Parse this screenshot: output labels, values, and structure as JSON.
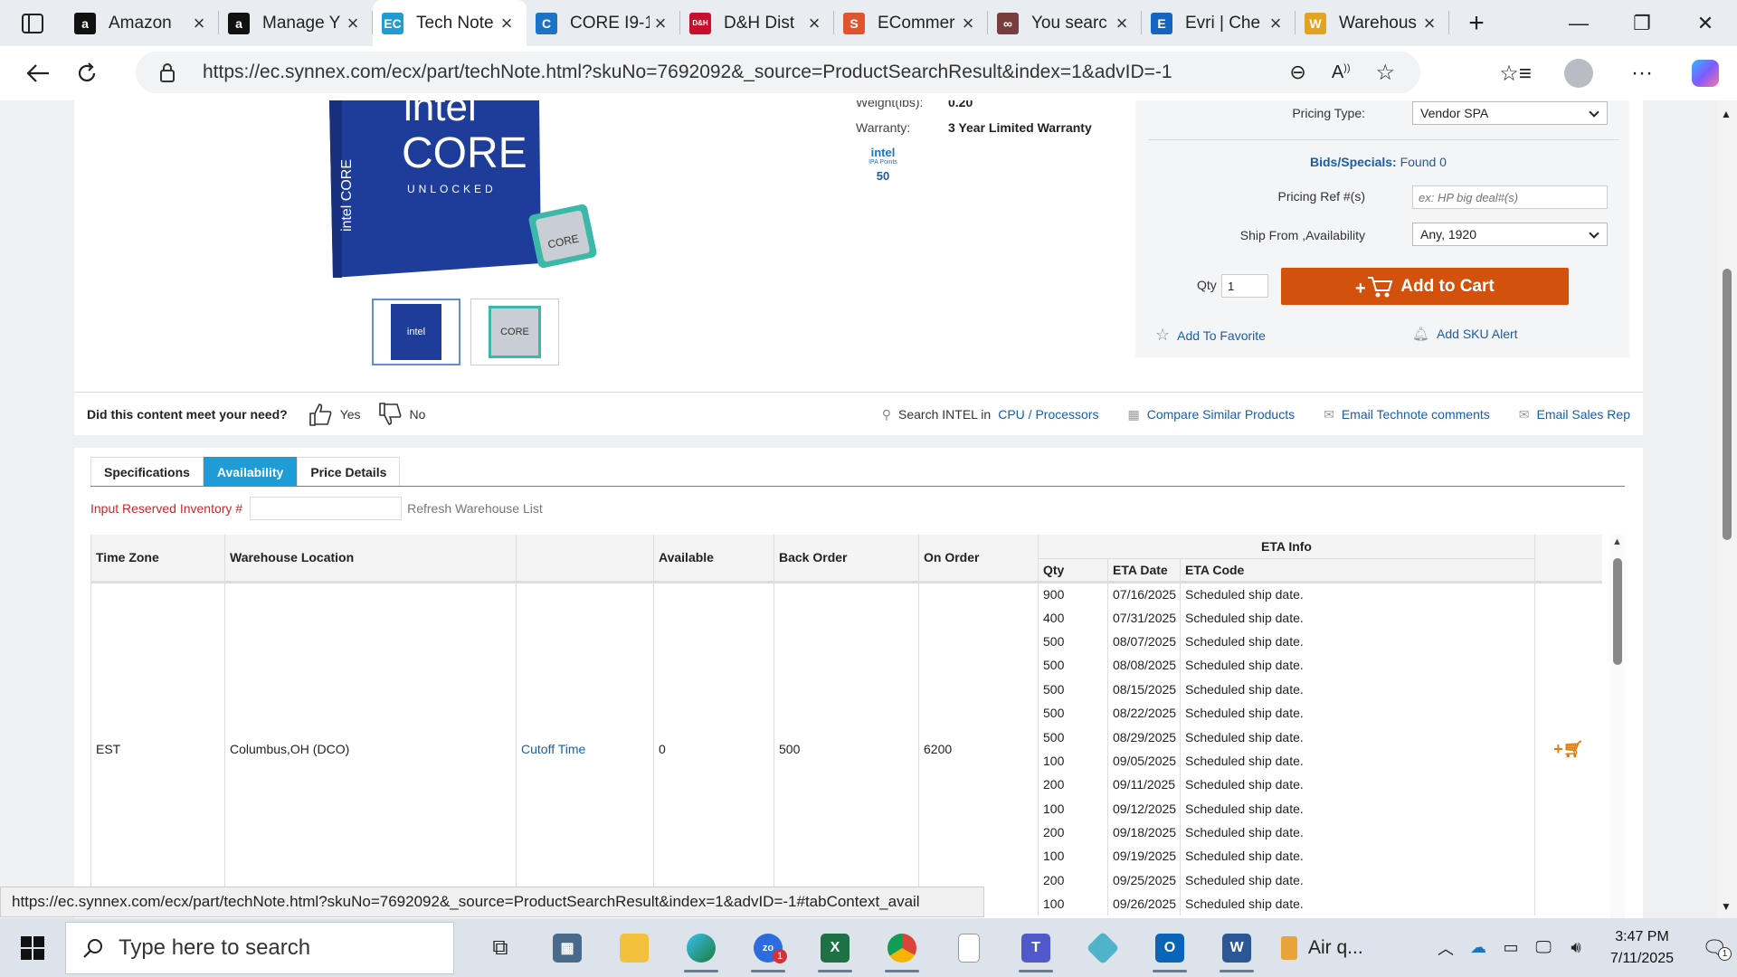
{
  "browser": {
    "tabs": [
      {
        "label": "Amazon",
        "icon": "amazon-icon",
        "color": "#111111",
        "glyph": "a"
      },
      {
        "label": "Manage Y",
        "icon": "amazon-icon",
        "color": "#111111",
        "glyph": "a"
      },
      {
        "label": "Tech Note",
        "icon": "ec-icon",
        "color": "#1f9cd6",
        "glyph": "EC",
        "active": true
      },
      {
        "label": "CORE I9-1",
        "icon": "synnex-icon",
        "color": "#1a73c8",
        "glyph": "C"
      },
      {
        "label": "D&H Dist",
        "icon": "dh-icon",
        "color": "#c8102e",
        "glyph": "D&H"
      },
      {
        "label": "ECommer",
        "icon": "ecommerce-icon",
        "color": "#e0542e",
        "glyph": "S"
      },
      {
        "label": "You searc",
        "icon": "search-logo-icon",
        "color": "#7a3d3d",
        "glyph": "∞"
      },
      {
        "label": "Evri | Che",
        "icon": "evri-icon",
        "color": "#1565c0",
        "glyph": "E"
      },
      {
        "label": "Warehous",
        "icon": "warehouse-icon",
        "color": "#e2a321",
        "glyph": "W"
      }
    ],
    "url": "https://ec.synnex.com/ecx/part/techNote.html?skuNo=7692092&_source=ProductSearchResult&index=1&advID=-1",
    "status_url": "https://ec.synnex.com/ecx/part/techNote.html?skuNo=7692092&_source=ProductSearchResult&index=1&advID=-1#tabContext_avail"
  },
  "product": {
    "box_brand": "intel",
    "box_line": "CORE",
    "box_tag": "UNLOCKED",
    "box_side": "intel CORE",
    "weight_label": "Weight(lbs):",
    "weight_value": "0.20",
    "warranty_label": "Warranty:",
    "warranty_value": "3 Year Limited Warranty",
    "ipa_brand": "intel",
    "ipa_label": "IPA Points",
    "ipa_points": "50"
  },
  "buy": {
    "pricing_type_label": "Pricing Type:",
    "pricing_type_value": "Vendor SPA",
    "bids_label": "Bids/Specials:",
    "bids_value": "Found 0",
    "pricing_ref_label": "Pricing Ref #(s)",
    "pricing_ref_placeholder": "ex: HP big deal#(s)",
    "ship_from_label": "Ship From ,Availability",
    "ship_from_value": "Any, 1920",
    "qty_label": "Qty",
    "qty_value": "1",
    "add_to_cart": "Add to Cart",
    "add_favorite": "Add To Favorite",
    "add_sku_alert": "Add SKU Alert"
  },
  "feedback": {
    "question": "Did this content meet your need?",
    "yes": "Yes",
    "no": "No",
    "search_prefix": "Search INTEL in",
    "search_category": "CPU / Processors",
    "compare": "Compare Similar Products",
    "email_comments": "Email Technote comments",
    "email_rep": "Email Sales Rep"
  },
  "details": {
    "tabs": [
      "Specifications",
      "Availability",
      "Price Details"
    ],
    "reserve_label": "Input Reserved Inventory #",
    "refresh": "Refresh Warehouse List",
    "headers": {
      "time_zone": "Time Zone",
      "warehouse": "Warehouse Location",
      "available": "Available",
      "back_order": "Back Order",
      "on_order": "On Order",
      "eta_info": "ETA Info",
      "qty": "Qty",
      "eta_date": "ETA Date",
      "eta_code": "ETA Code"
    },
    "row": {
      "time_zone": "EST",
      "warehouse": "Columbus,OH (DCO)",
      "cutoff": "Cutoff Time",
      "available": "0",
      "back_order": "500",
      "on_order": "6200"
    },
    "eta": [
      {
        "qty": "900",
        "date": "07/16/2025",
        "code": "Scheduled ship date."
      },
      {
        "qty": "400",
        "date": "07/31/2025",
        "code": "Scheduled ship date."
      },
      {
        "qty": "500",
        "date": "08/07/2025",
        "code": "Scheduled ship date."
      },
      {
        "qty": "500",
        "date": "08/08/2025",
        "code": "Scheduled ship date."
      },
      {
        "qty": "500",
        "date": "08/15/2025",
        "code": "Scheduled ship date."
      },
      {
        "qty": "500",
        "date": "08/22/2025",
        "code": "Scheduled ship date."
      },
      {
        "qty": "500",
        "date": "08/29/2025",
        "code": "Scheduled ship date."
      },
      {
        "qty": "100",
        "date": "09/05/2025",
        "code": "Scheduled ship date."
      },
      {
        "qty": "200",
        "date": "09/11/2025",
        "code": "Scheduled ship date."
      },
      {
        "qty": "100",
        "date": "09/12/2025",
        "code": "Scheduled ship date."
      },
      {
        "qty": "200",
        "date": "09/18/2025",
        "code": "Scheduled ship date."
      },
      {
        "qty": "100",
        "date": "09/19/2025",
        "code": "Scheduled ship date."
      },
      {
        "qty": "200",
        "date": "09/25/2025",
        "code": "Scheduled ship date."
      },
      {
        "qty": "100",
        "date": "09/26/2025",
        "code": "Scheduled ship date."
      }
    ]
  },
  "taskbar": {
    "search_placeholder": "Type here to search",
    "weather": "Air q...",
    "time": "3:47 PM",
    "date": "7/11/2025",
    "notifications": "1",
    "teams_badge": "1"
  },
  "colors": {
    "accent": "#1f9cd6",
    "cart_button": "#d2520d",
    "link": "#1a5ea8",
    "warning_label": "#c8282d"
  }
}
